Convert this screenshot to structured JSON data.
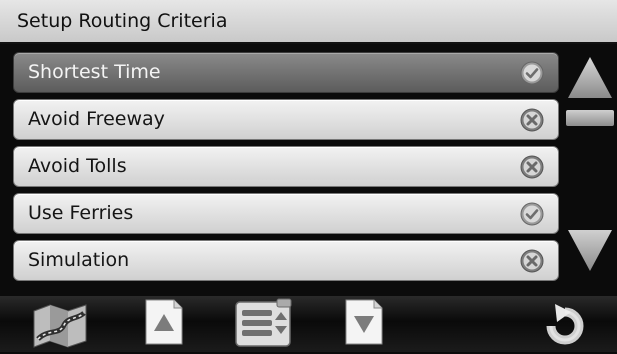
{
  "header": {
    "title": "Setup Routing Criteria"
  },
  "options": [
    {
      "label": "Shortest Time",
      "state": "on",
      "selected": true
    },
    {
      "label": "Avoid Freeway",
      "state": "off",
      "selected": false
    },
    {
      "label": "Avoid Tolls",
      "state": "off",
      "selected": false
    },
    {
      "label": "Use Ferries",
      "state": "on",
      "selected": false
    },
    {
      "label": "Simulation",
      "state": "off",
      "selected": false
    }
  ],
  "scrollbar": {
    "up_icon": "triangle-up-icon",
    "down_icon": "triangle-down-icon"
  },
  "toolbar": {
    "items": [
      "map-icon",
      "page-up-icon",
      "menu-list-icon",
      "page-down-icon",
      "back-arrow-icon"
    ]
  },
  "colors": {
    "background": "#0b0b0b",
    "row": "#e0e0e0",
    "row_selected": "#6f6f6f",
    "icon_fill": "#8c8c8c"
  }
}
